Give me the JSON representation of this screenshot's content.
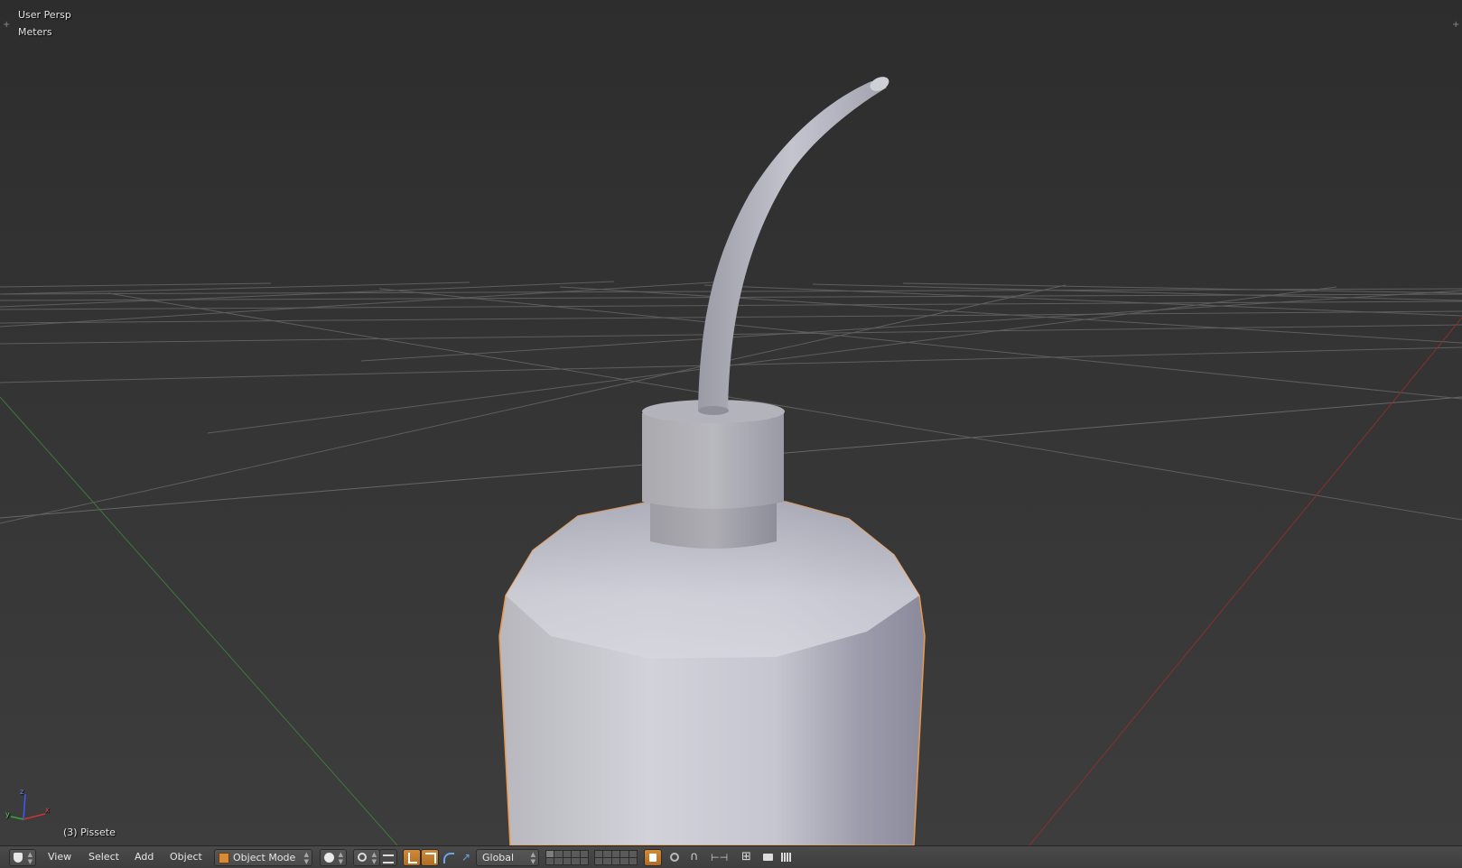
{
  "viewport": {
    "view_name": "User Persp",
    "units": "Meters",
    "object_info": "(3) Pissete",
    "axis_labels": {
      "x": "x",
      "y": "y",
      "z": "z"
    },
    "colors": {
      "background_top": "#2f2f2f",
      "background_bottom": "#3c3c3c",
      "grid": "#5d5d5d",
      "x_axis": "#8a2f2f",
      "y_axis": "#3c7a3c",
      "selection_outline": "#e89a4e",
      "model": "#c5c5cf"
    }
  },
  "header": {
    "editor_type_icon": "3d-view-icon",
    "menus": {
      "view": "View",
      "select": "Select",
      "add": "Add",
      "object": "Object"
    },
    "mode": {
      "icon": "cube-icon",
      "label": "Object Mode"
    },
    "viewport_shading_icon": "solid-sphere-icon",
    "pivot_icon": "pivot-point-icon",
    "manipulator_icons": [
      "translate-icon",
      "rotate-icon",
      "scale-icon"
    ],
    "transform_orientation": "Global",
    "accent_color": "#d18a3a"
  }
}
